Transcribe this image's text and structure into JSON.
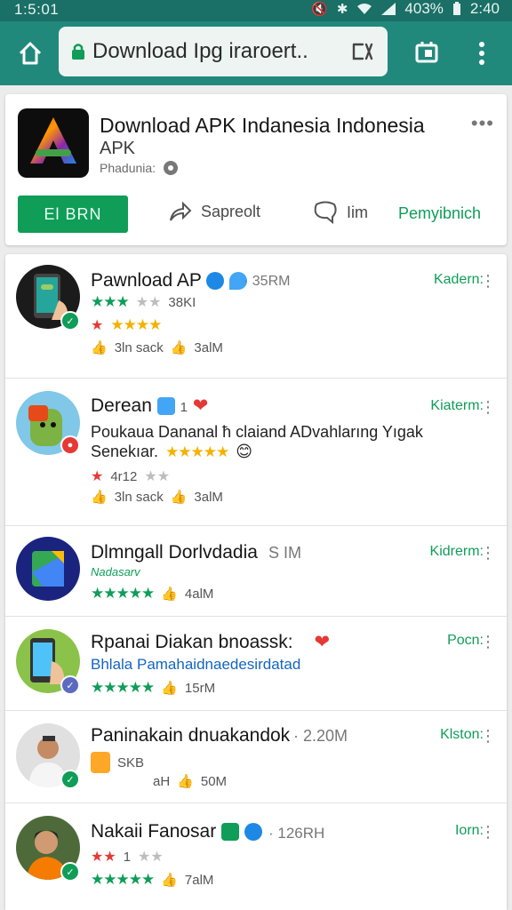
{
  "status_bar": {
    "time_left": "1:5:01",
    "battery": "403%",
    "time_right": "2:40",
    "icons": [
      "mute-icon",
      "bluetooth-icon",
      "wifi-icon",
      "signal-icon",
      "battery-icon"
    ]
  },
  "browser": {
    "home_icon": "home-icon",
    "url": "Download Ipg iraroert..",
    "lock_icon": "lock-icon",
    "url_action_icon": "edit-tab-icon",
    "tabs_icon": "tab-switcher-icon",
    "menu_icon": "vertical-dots-icon"
  },
  "top_card": {
    "title": "Download APK Indanesia Indonesia",
    "subtitle": "APK",
    "developer": "Phadunia:",
    "install_label": "El BRN",
    "share_label": "Sapreolt",
    "wishlist_label": "Iim",
    "extra_label": "Pemyibnich",
    "accent": "#0f9d58"
  },
  "list": [
    {
      "title": "Pawnload AP",
      "size": "· 35RM",
      "status": "Kadern:",
      "rating_text": "38KI",
      "likes": "3ln sack",
      "downloads": "3alM"
    },
    {
      "title": "Derean",
      "badge_count": "1",
      "status": "Kiaterm:",
      "desc_line1": "Poukaua Dananal ħ claiand ADvahlarıng Yıgak",
      "desc_line2": "Senekıar.",
      "rating_text": "4r12",
      "likes": "3ln sack",
      "downloads": "3alM"
    },
    {
      "title": "Dlmngall Dorlvdadia",
      "size": "S IM",
      "status": "Kidrerm:",
      "tag": "Nadasarv",
      "downloads": "4alM"
    },
    {
      "title": "Rpanai Diakan bnoassk:",
      "status": "Pocn:",
      "desc_blue": "Bhlala Pamahaidnaedesirdatad",
      "downloads": "15rM"
    },
    {
      "title": "Paninakain dnuakandok",
      "size": "· 2.20M",
      "status": "Klston:",
      "mini_text": "SKB",
      "mini_text2": "aH",
      "downloads": "50M"
    },
    {
      "title": "Nakaii Fanosar",
      "size": "· 126RH",
      "status": "Iorn:",
      "rating_text": "1",
      "downloads": "7alM"
    }
  ]
}
